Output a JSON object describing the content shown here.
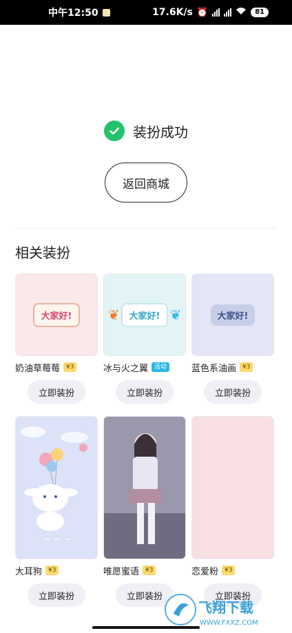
{
  "status_bar": {
    "time": "中午12:50",
    "net_speed": "17.6K/s",
    "battery": "81"
  },
  "success": {
    "text": "装扮成功"
  },
  "back_button": {
    "label": "返回商城"
  },
  "section": {
    "title": "相关装扮"
  },
  "items": [
    {
      "name": "奶油草莓莓",
      "badge": "¥3",
      "badge_type": "price",
      "bubble_text": "大家好!",
      "button": "立即装扮"
    },
    {
      "name": "冰与火之翼",
      "badge": "活动",
      "badge_type": "event",
      "bubble_text": "大家好!",
      "button": "立即装扮"
    },
    {
      "name": "蓝色系油画",
      "badge": "¥3",
      "badge_type": "price",
      "bubble_text": "大家好!",
      "button": "立即装扮"
    },
    {
      "name": "大耳狗",
      "badge": "¥3",
      "badge_type": "price",
      "button": "立即装扮"
    },
    {
      "name": "唯愿蜜语",
      "badge": "¥3",
      "badge_type": "price",
      "button": "立即装扮"
    },
    {
      "name": "恋爱粉",
      "badge": "¥3",
      "badge_type": "price",
      "button": "立即装扮"
    }
  ],
  "watermark": {
    "brand": "飞翔下载",
    "url": "WWW.FXXZ.COM"
  },
  "colors": {
    "success_green": "#23c26b",
    "price_badge": "#fbd96a",
    "event_badge": "#29b6e8"
  }
}
